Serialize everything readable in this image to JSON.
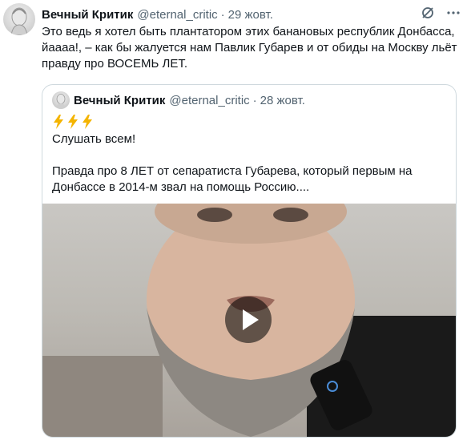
{
  "tweet": {
    "author_name": "Вечный Критик",
    "author_handle": "@eternal_critic",
    "separator": "·",
    "date": "29 жовт.",
    "text": "Это ведь я хотел быть плантатором этих банановых республик Донбасса, йаааа!, – как бы жалуется нам Павлик Губарев и от обиды на Москву льёт правду про ВОСЕМЬ ЛЕТ."
  },
  "quote": {
    "author_name": "Вечный Критик",
    "author_handle": "@eternal_critic",
    "separator": "·",
    "date": "28 жовт.",
    "line1": "Слушать всем!",
    "line2": "Правда про 8 ЛЕТ от сепаратиста Губарева, который первым на Донбассе в 2014-м звал на помощь Россию...."
  },
  "icons": {
    "settings": "settings-icon",
    "more": "more-icon",
    "lightning": "lightning-emoji-icon",
    "play": "play-icon"
  },
  "colors": {
    "text": "#0f1419",
    "muted": "#536471",
    "border": "#cfd9de",
    "lightning": "#f4b400"
  }
}
